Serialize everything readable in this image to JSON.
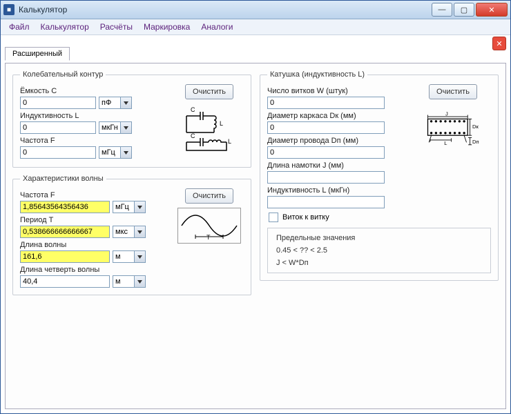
{
  "window": {
    "title": "Калькулятор"
  },
  "menu": {
    "file": "Файл",
    "calc": "Калькулятор",
    "compute": "Расчёты",
    "marking": "Маркировка",
    "analogs": "Аналоги"
  },
  "tab": {
    "main": "Расширенный"
  },
  "buttons": {
    "clear": "Очистить"
  },
  "osc": {
    "legend": "Колебательный контур",
    "cap_label": "Ёмкость C",
    "cap_value": "0",
    "cap_unit": "пФ",
    "ind_label": "Индуктивность L",
    "ind_value": "0",
    "ind_unit": "мкГн",
    "freq_label": "Частота F",
    "freq_value": "0",
    "freq_unit": "мГц"
  },
  "wave": {
    "legend": "Характеристики волны",
    "freq_label": "Частота F",
    "freq_value": "1,85643564356436",
    "freq_unit": "мГц",
    "period_label": "Период T",
    "period_value": "0,538666666666667",
    "period_unit": "мкс",
    "len_label": "Длина волны",
    "len_value": "161,6",
    "len_unit": "м",
    "qlen_label": "Длина четверть волны",
    "qlen_value": "40,4",
    "qlen_unit": "м"
  },
  "coil": {
    "legend": "Катушка (индуктивность L)",
    "turns_label": "Число витков W (штук)",
    "turns_value": "0",
    "diamk_label": "Диаметр каркаса Dк (мм)",
    "diamk_value": "0",
    "diamp_label": "Диаметр провода Dп (мм)",
    "diamp_value": "0",
    "len_label": "Длина намотки J (мм)",
    "len_value": "",
    "ind_label": "Индуктивность L (мкГн)",
    "ind_value": "",
    "turn2turn": "Виток к витку",
    "limits_header": "Предельные значения",
    "limit1": "0.45 < ?? < 2.5",
    "limit2": "J < W*Dп"
  },
  "diagram_labels": {
    "J": "J",
    "Dk": "Dк",
    "L": "L",
    "Dp": "Dп",
    "T": "T"
  }
}
